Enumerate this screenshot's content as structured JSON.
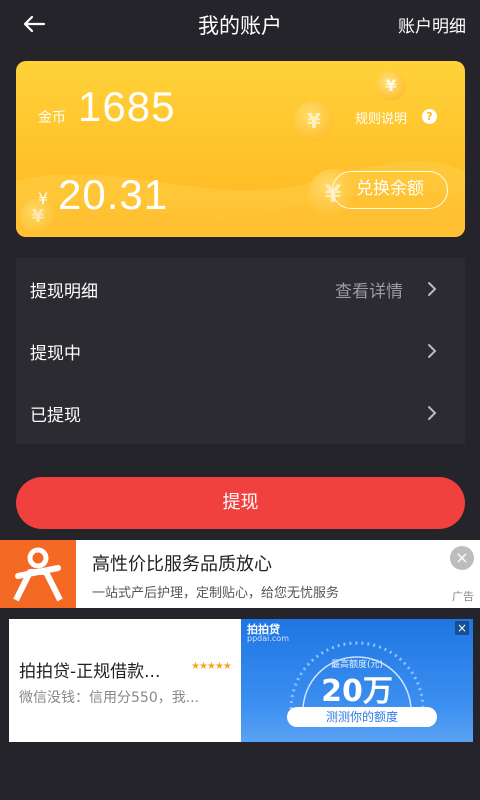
{
  "header": {
    "title": "我的账户",
    "detail_link": "账户明细"
  },
  "card": {
    "coin_label": "金币",
    "coin_value": "1685",
    "rules_label": "规则说明",
    "rules_icon": "?",
    "yuan_sign": "¥",
    "yuan_value": "20.31",
    "exchange_button": "兑换余额",
    "coin_symbol": "¥"
  },
  "list": {
    "items": [
      {
        "label": "提现明细",
        "right": "查看详情"
      },
      {
        "label": "提现中",
        "right": ""
      },
      {
        "label": "已提现",
        "right": ""
      }
    ]
  },
  "withdraw_button": "提现",
  "ad1": {
    "title": "高性价比服务品质放心",
    "subtitle": "一站式产后护理，定制贴心，给您无忧服务",
    "close": "×",
    "tag": "广告"
  },
  "ad2": {
    "title": "拍拍贷-正规借款...",
    "stars": "★★★★★",
    "subtitle": "微信没钱：信用分550，我...",
    "brand": "拍拍贷",
    "brand_url": "ppdai.com",
    "close": "×",
    "limit_label": "最高额度(元)",
    "amount": "20万",
    "cta": "测测你的额度"
  },
  "colors": {
    "background": "#24242a",
    "card_gold": "#ffc22b",
    "withdraw_red": "#f0413f",
    "ad_orange": "#f46a25",
    "ad_blue": "#1e76e3"
  }
}
